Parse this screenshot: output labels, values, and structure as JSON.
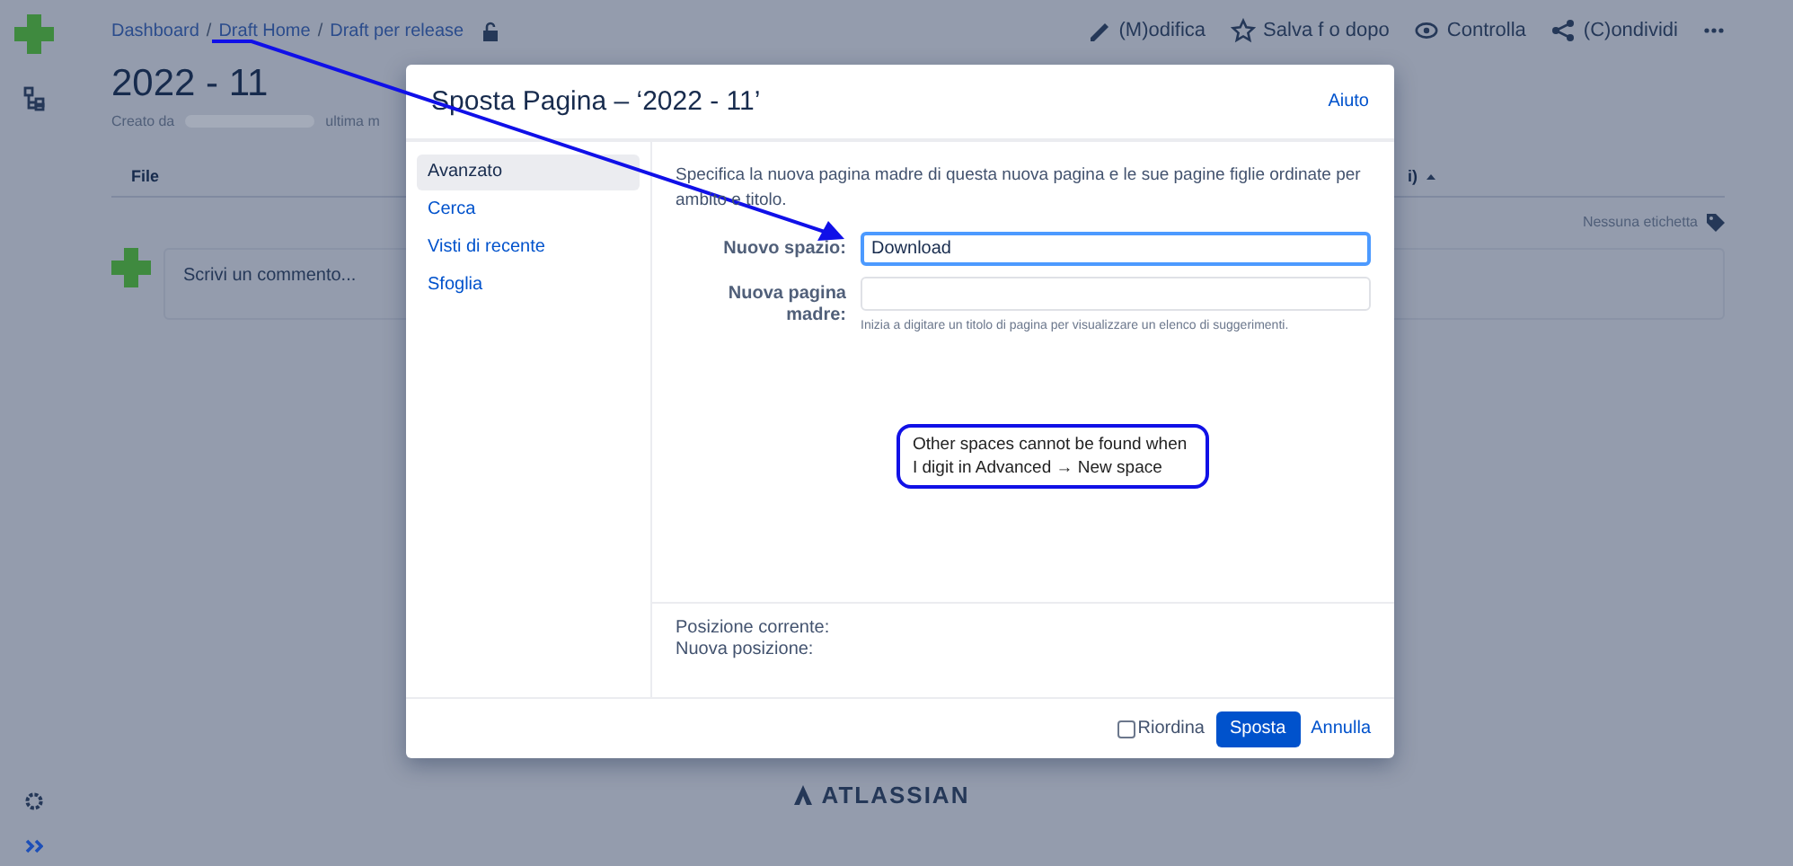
{
  "breadcrumbs": [
    {
      "label": "Dashboard"
    },
    {
      "separator": "/",
      "label": "Draft Home"
    },
    {
      "separator": "/",
      "label": "Draft per release"
    }
  ],
  "page_actions": [
    {
      "label": "(M)odifica",
      "kind": "edit"
    },
    {
      "label": "Salva f o dopo",
      "kind": "star"
    },
    {
      "label": "Controlla",
      "kind": "watch"
    },
    {
      "label": "(C)ondividi",
      "kind": "share"
    }
  ],
  "page": {
    "title": "2022 - 11",
    "byline_prefix": "Creato da",
    "byline_suffix": "ultima m",
    "column_1": "File",
    "column_2": "i)",
    "labels": "Nessuna etichetta",
    "comment_placeholder": "Scrivi un commento..."
  },
  "footer_logo": "ATLASSIAN",
  "dialog": {
    "title": "Sposta Pagina – ‘2022 - 11’",
    "help": "Aiuto",
    "nav": [
      {
        "label": "Avanzato",
        "selected": true
      },
      {
        "label": "Cerca",
        "selected": false
      },
      {
        "label": "Visti di recente",
        "selected": false
      },
      {
        "label": "Sfoglia",
        "selected": false
      }
    ],
    "description": "Specifica la nuova pagina madre di questa nuova pagina e le sue pagine figlie ordinate per ambito e titolo.",
    "fields": [
      {
        "label": "Nuovo spazio:",
        "value": "Download",
        "focused": true
      },
      {
        "label": "Nuova pagina madre:",
        "focused": false,
        "hint": "Inizia a digitare un titolo di pagina per visualizzare un elenco di suggerimenti."
      }
    ],
    "current_position_label": "Posizione corrente:",
    "new_position_label": "Nuova posizione:",
    "reorder": {
      "label": "Riordina",
      "checked": false
    },
    "buttons": [
      {
        "label": "Sposta",
        "kind": "primary"
      },
      {
        "label": "Annulla",
        "kind": "link"
      }
    ]
  },
  "annotation": {
    "text": "Other spaces cannot be found when I digit in Advanced → New space"
  }
}
